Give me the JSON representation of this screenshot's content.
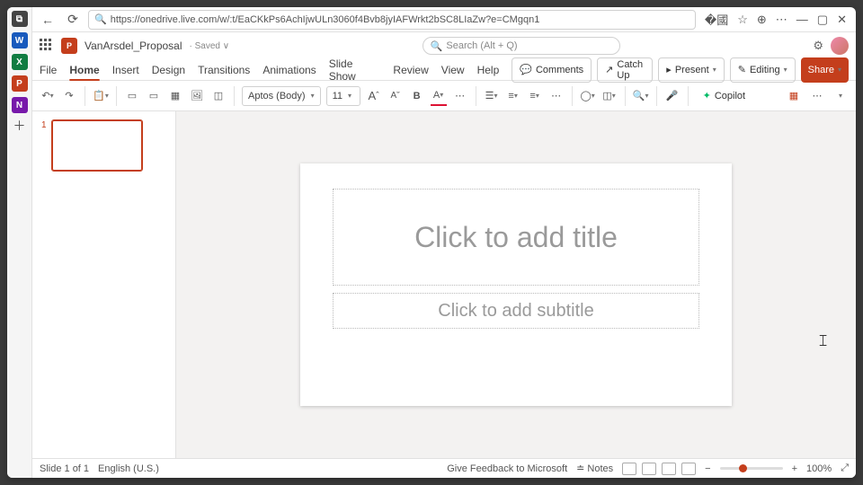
{
  "browser": {
    "url": "https://onedrive.live.com/w/:t/EaCKkPs6AchIjwULn3060f4Bvb8jyIAFWrkt2bSC8LIaZw?e=CMgqn1"
  },
  "title": {
    "doc_name": "VanArsdel_Proposal",
    "saved_state": "· Saved ∨",
    "search_placeholder": "Search (Alt + Q)"
  },
  "tabs": [
    "File",
    "Home",
    "Insert",
    "Design",
    "Transitions",
    "Animations",
    "Slide Show",
    "Review",
    "View",
    "Help"
  ],
  "top_buttons": {
    "comments": "Comments",
    "catchup": "Catch Up",
    "present": "Present",
    "editing": "Editing",
    "share": "Share"
  },
  "ribbon": {
    "font_name": "Aptos (Body)",
    "font_size": "11",
    "increase": "A",
    "decrease": "A",
    "bold": "B",
    "fontcolor": "A",
    "copilot": "Copilot"
  },
  "slide": {
    "title_ph": "Click to add title",
    "subtitle_ph": "Click to add subtitle"
  },
  "status": {
    "slide": "Slide 1 of 1",
    "lang": "English (U.S.)",
    "feedback": "Give Feedback to Microsoft",
    "notes": "Notes",
    "zoom": "100%"
  },
  "thumb_no": "1"
}
